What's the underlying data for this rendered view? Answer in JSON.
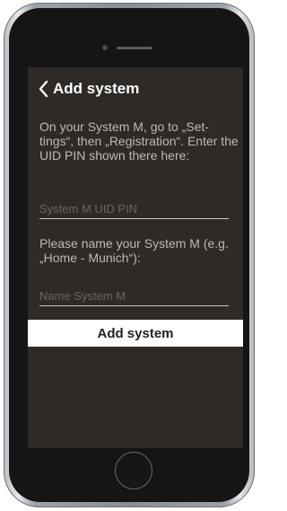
{
  "header": {
    "title": "Add system"
  },
  "form": {
    "instructions": "On your System M, go to „Set-tings“, then „Registration“. Enter the UID PIN shown there here:",
    "uid_placeholder": "System M UID PIN",
    "name_prompt": "Please name your System M (e.g. „Home - Munich“):",
    "name_placeholder": "Name System M",
    "submit_label": "Add system"
  },
  "icons": {
    "back": "chevron-left-icon"
  },
  "colors": {
    "screen_background": "#2e2a27",
    "text": "#bcb9b6",
    "title": "#ffffff",
    "button_background": "#ffffff",
    "button_text": "#222222",
    "phone_frame": "#151515"
  }
}
